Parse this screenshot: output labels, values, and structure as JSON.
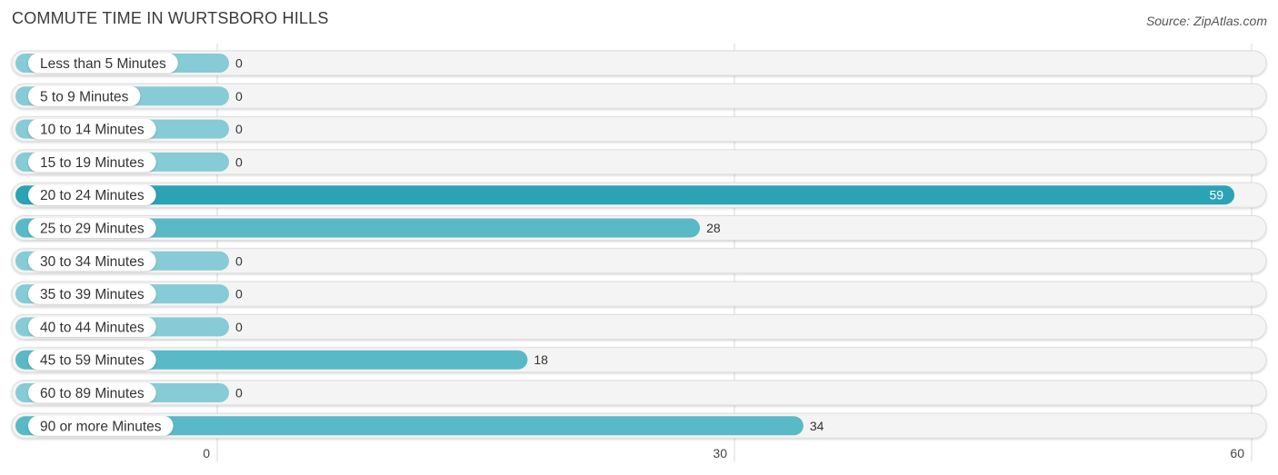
{
  "header": {
    "title": "COMMUTE TIME IN WURTSBORO HILLS",
    "source": "Source: ZipAtlas.com"
  },
  "chart_data": {
    "type": "bar",
    "orientation": "horizontal",
    "title": "COMMUTE TIME IN WURTSBORO HILLS",
    "xlabel": "",
    "ylabel": "",
    "categories": [
      "Less than 5 Minutes",
      "5 to 9 Minutes",
      "10 to 14 Minutes",
      "15 to 19 Minutes",
      "20 to 24 Minutes",
      "25 to 29 Minutes",
      "30 to 34 Minutes",
      "35 to 39 Minutes",
      "40 to 44 Minutes",
      "45 to 59 Minutes",
      "60 to 89 Minutes",
      "90 or more Minutes"
    ],
    "values": [
      0,
      0,
      0,
      0,
      59,
      28,
      0,
      0,
      0,
      18,
      0,
      34
    ],
    "xlim": [
      0,
      60
    ],
    "xticks": [
      0,
      30,
      60
    ],
    "xtick_labels": [
      "0",
      "30",
      "60"
    ],
    "grid": true,
    "legend": "none",
    "colors": {
      "max": "#2ba3b5",
      "normal": "#5ab9c7",
      "zero": "#86cbd6",
      "track": "#f4f4f4",
      "track_border": "#dddddd",
      "grid": "#d8d8d8"
    }
  }
}
